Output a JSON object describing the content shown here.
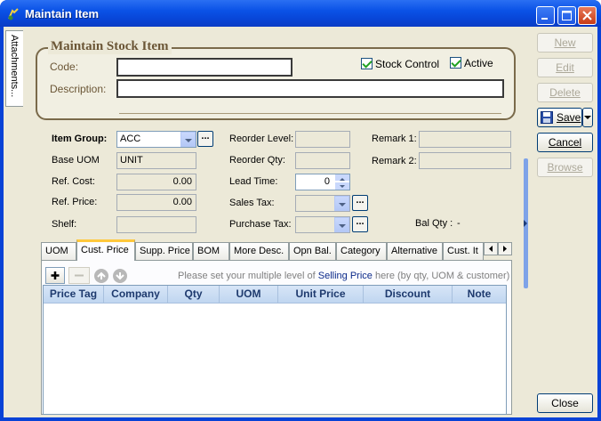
{
  "window": {
    "title": "Maintain Item"
  },
  "side_tab": {
    "label": "Attachments..."
  },
  "section": {
    "title": "Maintain Stock Item"
  },
  "form": {
    "code_label": "Code:",
    "code_value": "",
    "description_label": "Description:",
    "description_value": "",
    "stock_control_label": "Stock Control",
    "active_label": "Active",
    "item_group_label": "Item Group:",
    "item_group_value": "ACC",
    "base_uom_label": "Base UOM",
    "base_uom_value": "UNIT",
    "ref_cost_label": "Ref. Cost:",
    "ref_cost_value": "0.00",
    "ref_price_label": "Ref. Price:",
    "ref_price_value": "0.00",
    "shelf_label": "Shelf:",
    "reorder_level_label": "Reorder Level:",
    "reorder_qty_label": "Reorder Qty:",
    "lead_time_label": "Lead Time:",
    "lead_time_value": "0",
    "sales_tax_label": "Sales Tax:",
    "purchase_tax_label": "Purchase Tax:",
    "remark1_label": "Remark 1:",
    "remark2_label": "Remark 2:",
    "bal_qty_label": "Bal Qty :",
    "bal_qty_value": "-"
  },
  "tabs": [
    "UOM",
    "Cust. Price",
    "Supp. Price",
    "BOM",
    "More Desc.",
    "Opn Bal.",
    "Category",
    "Alternative",
    "Cust. It"
  ],
  "price_panel": {
    "hint_prefix": "Please set your multiple level of ",
    "hint_link": "Selling Price",
    "hint_suffix": " here  (by qty, UOM & customer)",
    "columns": [
      "Price Tag",
      "Company",
      "Qty",
      "UOM",
      "Unit Price",
      "Discount",
      "Note"
    ]
  },
  "side_buttons": {
    "new": "New",
    "edit": "Edit",
    "delete": "Delete",
    "save": "Save",
    "cancel": "Cancel",
    "browse": "Browse",
    "close": "Close"
  }
}
